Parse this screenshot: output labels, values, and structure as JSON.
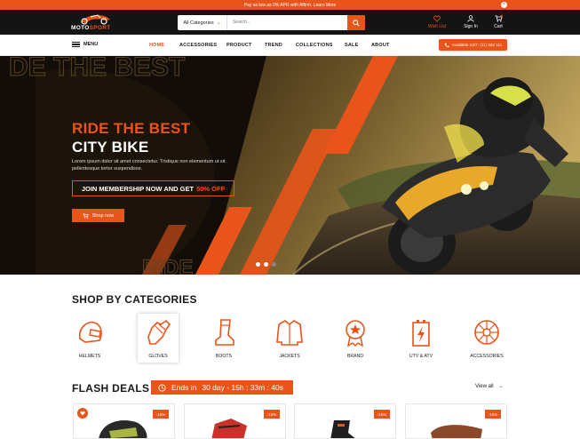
{
  "promo": {
    "text": "Pay as low as 0% APR with Affirm. Learn More",
    "close": "×"
  },
  "header": {
    "logo_main": "MOTO",
    "logo_accent": "SPORT",
    "search": {
      "category": "All Categories",
      "placeholder": "Search..."
    },
    "wishlist_label": "Wish List",
    "signin_label": "Sign In",
    "cart_label": "Cart",
    "cart_count": "0"
  },
  "nav": {
    "menu_label": "MENU",
    "items": [
      "HOME",
      "ACCESSORIES",
      "PRODUCT",
      "TREND",
      "COLLECTIONS",
      "SALE",
      "ABOUT"
    ],
    "available": "Available 24/7: (11) 333 111"
  },
  "hero": {
    "watermark_top": "DE THE BEST",
    "watermark_bottom": "RIDE",
    "title_line1": "RIDE THE BEST",
    "title_line2": "CITY BIKE",
    "description": "Lorem ipsum dolor sit amet consectetur. Tristique non elementum ut sit pellentesque tortor suspendisse.",
    "membership_text": "JOIN MEMBERSHIP NOW AND GET",
    "membership_discount": "50% OFF",
    "shop_button": "Shop now",
    "slides": 3,
    "active_slide": 2
  },
  "categories": {
    "title": "SHOP BY CATEGORIES",
    "items": [
      {
        "label": "HELMETS",
        "icon": "helmet-icon"
      },
      {
        "label": "GLOVES",
        "icon": "glove-icon"
      },
      {
        "label": "BOOTS",
        "icon": "boot-icon"
      },
      {
        "label": "JACKETS",
        "icon": "jacket-icon"
      },
      {
        "label": "BRAND",
        "icon": "badge-icon"
      },
      {
        "label": "UTV & ATV",
        "icon": "battery-icon"
      },
      {
        "label": "ACCESSORIES",
        "icon": "wheel-icon"
      }
    ],
    "selected": "GLOVES"
  },
  "flash": {
    "title": "FLASH DEALS",
    "timer_prefix": "Ends in",
    "timer_value": "30 day - 15h : 33m : 40s",
    "view_all": "View all",
    "cards": [
      {
        "badge": "-15%"
      },
      {
        "badge": "-15%"
      },
      {
        "badge": "-15%"
      },
      {
        "badge": "-15%"
      }
    ]
  },
  "colors": {
    "accent": "#e8541a",
    "dark": "#141414"
  }
}
